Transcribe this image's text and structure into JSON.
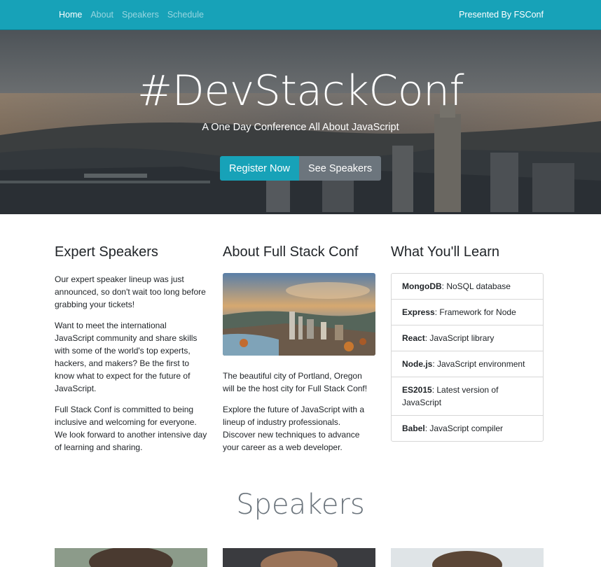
{
  "nav": {
    "links": [
      "Home",
      "About",
      "Speakers",
      "Schedule"
    ],
    "right_text": "Presented By FSConf"
  },
  "hero": {
    "title": "#DevStackConf",
    "subtitle": "A One Day Conference All About JavaScript",
    "register_label": "Register Now",
    "speakers_label": "See Speakers"
  },
  "col1": {
    "heading": "Expert Speakers",
    "p1": "Our expert speaker lineup was just announced, so don't wait too long before grabbing your tickets!",
    "p2": "Want to meet the international JavaScript community and share skills with some of the world's top experts, hackers, and makers? Be the first to know what to expect for the future of JavaScript.",
    "p3": "Full Stack Conf is committed to being inclusive and welcoming for everyone. We look forward to another intensive day of learning and sharing."
  },
  "col2": {
    "heading": "About Full Stack Conf",
    "p1": "The beautiful city of Portland, Oregon will be the host city for Full Stack Conf!",
    "p2": "Explore the future of JavaScript with a lineup of industry professionals. Discover new techniques to advance your career as a web developer."
  },
  "col3": {
    "heading": "What You'll Learn",
    "items": [
      {
        "name": "MongoDB",
        "desc": ": NoSQL database"
      },
      {
        "name": "Express",
        "desc": ": Framework for Node"
      },
      {
        "name": "React",
        "desc": ": JavaScript library"
      },
      {
        "name": "Node.js",
        "desc": ": JavaScript environment"
      },
      {
        "name": "ES2015",
        "desc": ": Latest version of JavaScript"
      },
      {
        "name": "Babel",
        "desc": ": JavaScript compiler"
      }
    ]
  },
  "speakers_heading": "Speakers",
  "colors": {
    "navbar": "#17a2b8",
    "secondary": "#6c757d"
  }
}
